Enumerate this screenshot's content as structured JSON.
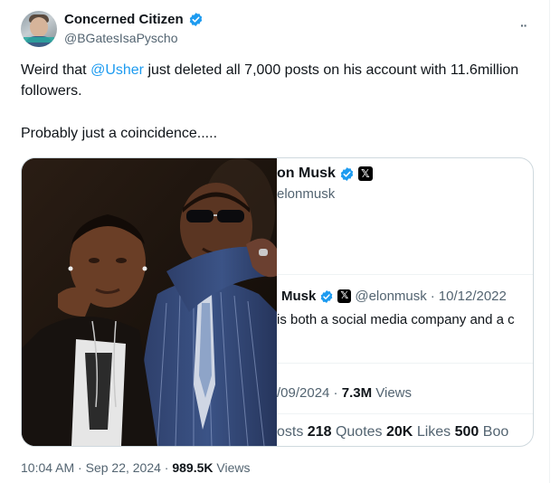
{
  "author": {
    "name": "Concerned Citizen",
    "handle": "@BGatesIsaPyscho"
  },
  "tweet": {
    "text_before_mention": "Weird that ",
    "mention": "@Usher",
    "text_after_mention": " just deleted all 7,000 posts on his account with 11.6million followers.",
    "second_line": "Probably just a coincidence....."
  },
  "embed": {
    "profile_name_fragment": "on Musk",
    "profile_handle_fragment": "elonmusk",
    "post_name_fragment": "Musk",
    "post_handle": "@elonmusk",
    "post_sep": "·",
    "post_date": "10/12/2022",
    "post_text_fragment": "is both a social media company and a c",
    "meta_date_fragment": "/09/2024",
    "meta_sep": " · ",
    "meta_views_value": "7.3M",
    "meta_views_label": " Views",
    "stats_posts_fragment": "osts",
    "stats_quotes_value": "218",
    "stats_quotes_label": "Quotes",
    "stats_likes_value": "20K",
    "stats_likes_label": "Likes",
    "stats_bookmarks_value": "500",
    "stats_bookmarks_label": "Boo"
  },
  "footer": {
    "time": "10:04 AM",
    "sep1": " · ",
    "date": "Sep 22, 2024",
    "sep2": " · ",
    "views_value": "989.5K",
    "views_label": " Views"
  },
  "colors": {
    "verified_blue": "#1d9bf0",
    "mention": "#1d9bf0",
    "secondary_text": "#536471"
  },
  "icons": {
    "verified": "verified-badge-icon",
    "x_logo": "x-logo-icon",
    "more": "more-icon"
  }
}
